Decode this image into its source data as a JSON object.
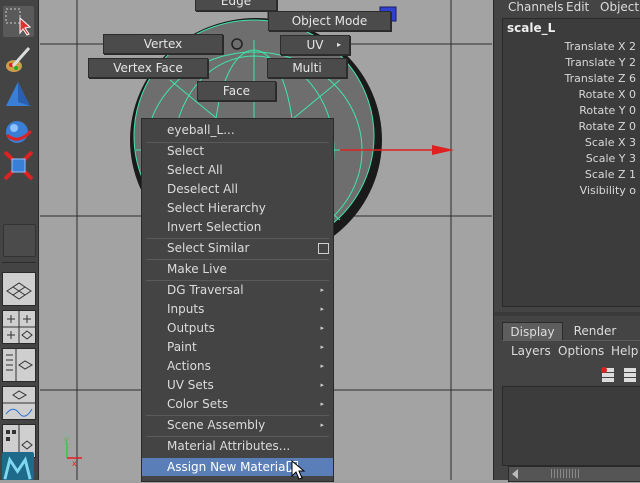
{
  "marking_menu": {
    "edge": "Edge",
    "object_mode": "Object Mode",
    "vertex": "Vertex",
    "uv": "UV",
    "uv_arrow": "▸",
    "vertex_face": "Vertex Face",
    "multi": "Multi",
    "face": "Face"
  },
  "context_menu": {
    "title": "eyeball_L...",
    "items": [
      "Select",
      "Select All",
      "Deselect All",
      "Select Hierarchy",
      "Invert Selection",
      "Select Similar",
      "Make Live",
      "DG Traversal",
      "Inputs",
      "Outputs",
      "Paint",
      "Actions",
      "UV Sets",
      "Color Sets",
      "Scene Assembly",
      "Material Attributes...",
      "Assign New Material..."
    ],
    "submenu_glyph": "▸"
  },
  "channel_box": {
    "menus": [
      "Channels",
      "Edit",
      "Object"
    ],
    "object_name": "scale_L",
    "attributes": [
      "Translate X 2",
      "Translate Y 2",
      "Translate Z 6",
      "Rotate X 0",
      "Rotate Y 0",
      "Rotate Z 0",
      "Scale X 3",
      "Scale Y 3",
      "Scale Z 1",
      "Visibility o"
    ]
  },
  "layer_editor": {
    "tabs": [
      "Display",
      "Render"
    ],
    "menus": [
      "Layers",
      "Options",
      "Help"
    ]
  },
  "colors": {
    "panel": "#444444",
    "viewport": "#a3a3a3",
    "wireframe": "#3ee6a8",
    "highlight": "#5a7fb8",
    "axis_red": "#e02020"
  },
  "icons": [
    "select-tool-icon",
    "lasso-tool-icon",
    "paint-tool-icon",
    "move-tool-icon",
    "rotate-tool-icon",
    "scale-tool-icon"
  ]
}
